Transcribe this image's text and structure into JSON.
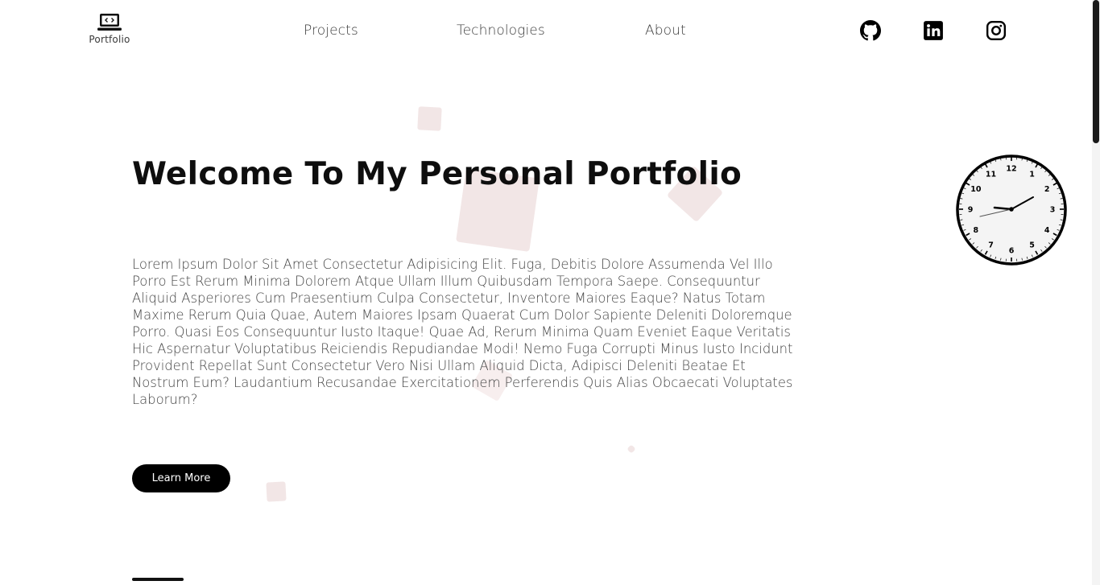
{
  "header": {
    "logo_label": "Portfolio",
    "nav": [
      {
        "label": "Projects"
      },
      {
        "label": "Technologies"
      },
      {
        "label": "About"
      }
    ],
    "social_icons": [
      "github-icon",
      "linkedin-icon",
      "instagram-icon"
    ]
  },
  "hero": {
    "title": "Welcome To My Personal Portfolio",
    "text": "Lorem Ipsum Dolor Sit Amet Consectetur Adipisicing Elit. Fuga, Debitis Dolore Assumenda Vel Illo Porro Est Rerum Minima Dolorem Atque Ullam Illum Quibusdam Tempora Saepe. Consequuntur Aliquid Asperiores Cum Praesentium Culpa Consectetur, Inventore Maiores Eaque? Natus Totam Maxime Rerum Quia Quae, Autem Maiores Ipsam Quaerat Cum Dolor Sapiente Deleniti Doloremque Porro. Quasi Eos Consequuntur Iusto Itaque! Quae Ad, Rerum Minima Quam Eveniet Eaque Veritatis Hic Aspernatur Voluptatibus Reiciendis Repudiandae Modi! Nemo Fuga Corrupti Minus Iusto Incidunt Provident Repellat Sunt Consectetur Vero Nisi Ullam Aliquid Dicta, Adipisci Deleniti Beatae Et Nostrum Eum? Laudantium Recusandae Exercitationem Perferendis Quis Alias Obcaecati Voluptates Laborum?",
    "button_label": "Learn More"
  },
  "clock": {
    "numbers": [
      "12",
      "1",
      "2",
      "3",
      "4",
      "5",
      "6",
      "7",
      "8",
      "9",
      "10",
      "11"
    ]
  },
  "colors": {
    "accent": "#000000",
    "deco": "#f1e3e3",
    "text": "#444444"
  }
}
